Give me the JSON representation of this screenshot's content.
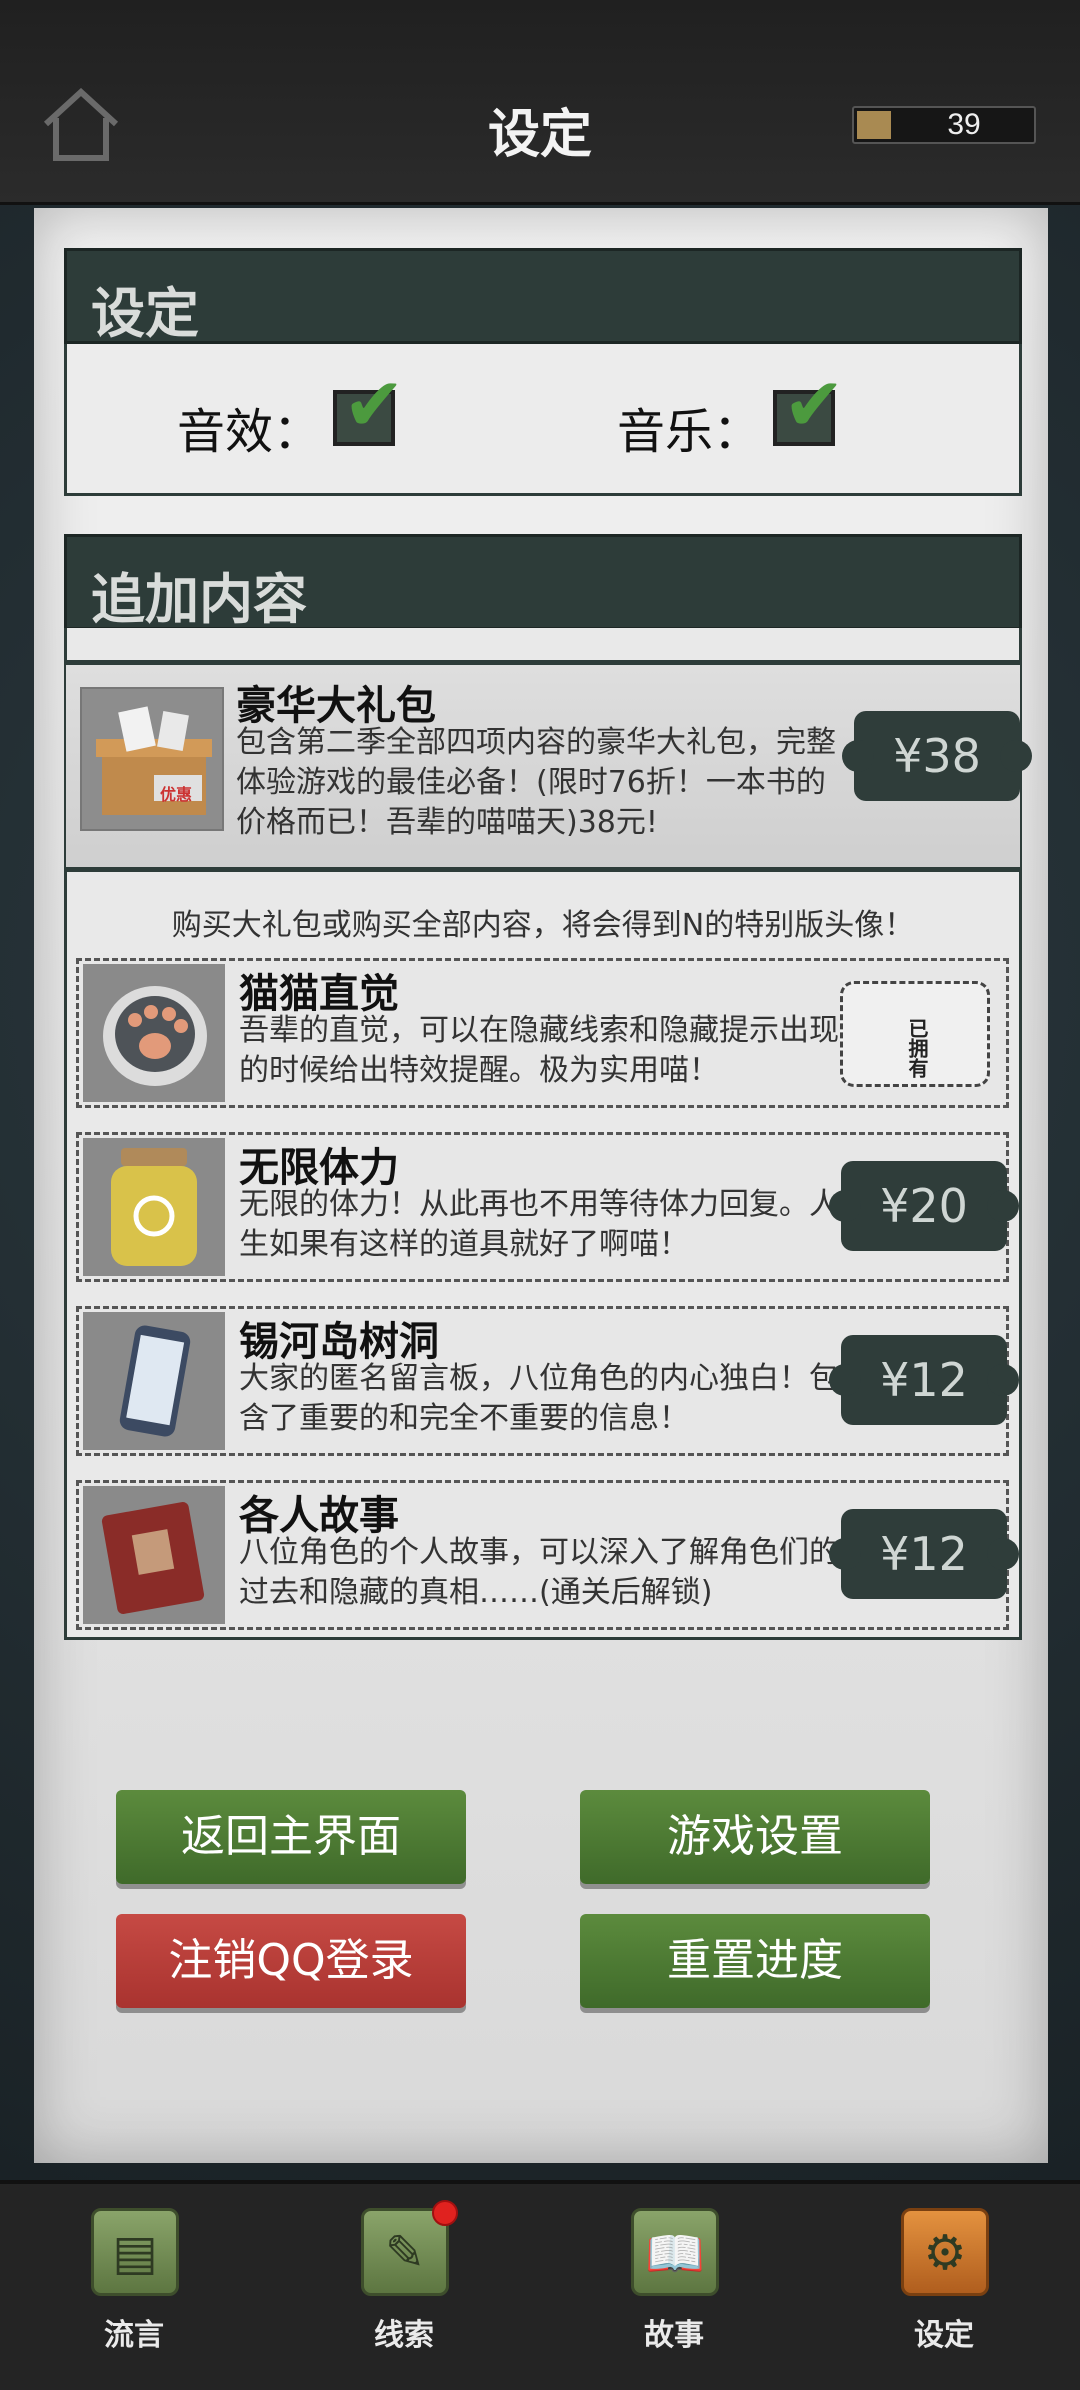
{
  "header": {
    "title": "设定",
    "energy": "39"
  },
  "settings": {
    "section_title": "设定",
    "sound_label": "音效：",
    "music_label": "音乐："
  },
  "dlc": {
    "section_title": "追加内容",
    "bundle": {
      "title": "豪华大礼包",
      "desc": "包含第二季全部四项内容的豪华大礼包，完整体验游戏的最佳必备！(限时76折！一本书的价格而已！吾辈的喵喵天)38元!",
      "price": "¥38",
      "thumb_text": "优惠"
    },
    "promo": "购买大礼包或购买全部内容，将会得到N的特别版头像！",
    "items": [
      {
        "title": "猫猫直觉",
        "desc": "吾辈的直觉，可以在隐藏线索和隐藏提示出现的时候给出特效提醒。极为实用喵！",
        "status": "已拥有"
      },
      {
        "title": "无限体力",
        "desc": "无限的体力！从此再也不用等待体力回复。人生如果有这样的道具就好了啊喵！",
        "price": "¥20"
      },
      {
        "title": "锡河岛树洞",
        "desc": "大家的匿名留言板，八位角色的内心独白！包含了重要的和完全不重要的信息！",
        "price": "¥12"
      },
      {
        "title": "各人故事",
        "desc": "八位角色的个人故事，可以深入了解角色们的过去和隐藏的真相……(通关后解锁)",
        "price": "¥12"
      }
    ]
  },
  "buttons": {
    "main_menu": "返回主界面",
    "game_settings": "游戏设置",
    "logout_qq": "注销QQ登录",
    "reset_progress": "重置进度"
  },
  "nav": [
    {
      "label": "流言",
      "icon": "rumor-icon"
    },
    {
      "label": "线索",
      "icon": "clue-icon"
    },
    {
      "label": "故事",
      "icon": "story-book-icon"
    },
    {
      "label": "设定",
      "icon": "settings-gear-icon"
    }
  ]
}
